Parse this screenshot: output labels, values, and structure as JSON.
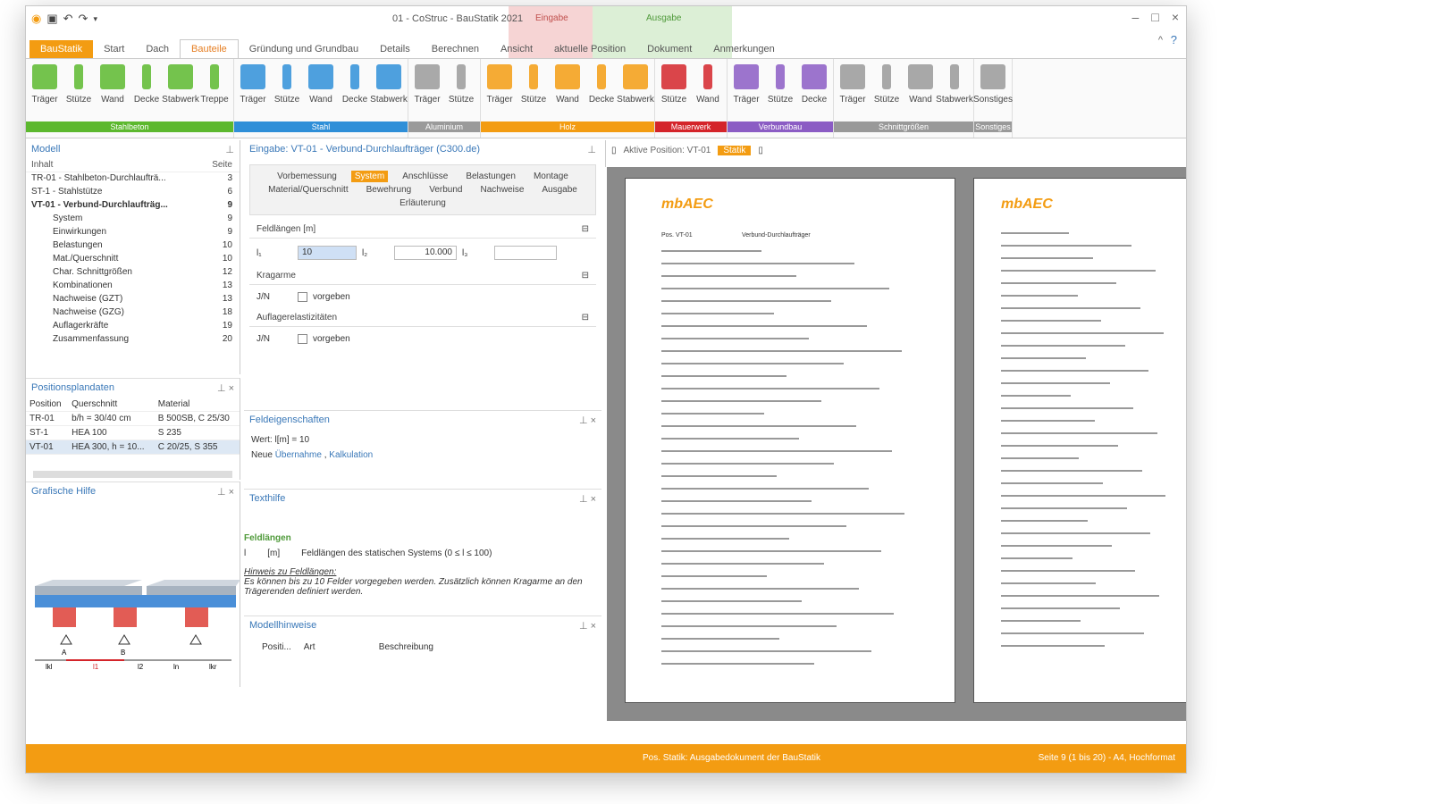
{
  "window": {
    "title": "01 - CoStruc - BauStatik 2021",
    "context_eingabe": "Eingabe",
    "context_ausgabe": "Ausgabe",
    "controls": [
      "–",
      "□",
      "×"
    ],
    "help": [
      "^",
      "?"
    ]
  },
  "tabs": [
    {
      "label": "BauStatik"
    },
    {
      "label": "Start"
    },
    {
      "label": "Dach"
    },
    {
      "label": "Bauteile"
    },
    {
      "label": "Gründung und Grundbau"
    },
    {
      "label": "Details"
    },
    {
      "label": "Berechnen"
    },
    {
      "label": "Ansicht"
    },
    {
      "label": "aktuelle Position"
    },
    {
      "label": "Dokument"
    },
    {
      "label": "Anmerkungen"
    }
  ],
  "ribbon": {
    "groups": [
      {
        "label": "Stahlbeton",
        "color": "#5cb82e",
        "items": [
          "Träger",
          "Stütze",
          "Wand",
          "Decke",
          "Stabwerk",
          "Treppe"
        ]
      },
      {
        "label": "Stahl",
        "color": "#2f8fd8",
        "items": [
          "Träger",
          "Stütze",
          "Wand",
          "Decke",
          "Stabwerk"
        ]
      },
      {
        "label": "Aluminium",
        "color": "#9a9a9a",
        "items": [
          "Träger",
          "Stütze"
        ]
      },
      {
        "label": "Holz",
        "color": "#f39c12",
        "items": [
          "Träger",
          "Stütze",
          "Wand",
          "Decke",
          "Stabwerk"
        ]
      },
      {
        "label": "Mauerwerk",
        "color": "#d4242a",
        "items": [
          "Stütze",
          "Wand"
        ]
      },
      {
        "label": "Verbundbau",
        "color": "#8b5cc4",
        "items": [
          "Träger",
          "Stütze",
          "Decke"
        ]
      },
      {
        "label": "Schnittgrößen",
        "color": "#999999",
        "items": [
          "Träger",
          "Stütze",
          "Wand",
          "Stabwerk"
        ]
      },
      {
        "label": "Sonstiges",
        "color": "#999999",
        "items": [
          "Sonstiges"
        ]
      }
    ]
  },
  "modell": {
    "title": "Modell",
    "col_inhalt": "Inhalt",
    "col_seite": "Seite",
    "rows": [
      {
        "label": "TR-01 - Stahlbeton-Durchlaufträ...",
        "page": "3"
      },
      {
        "label": "ST-1 - Stahlstütze",
        "page": "6"
      },
      {
        "label": "VT-01 - Verbund-Durchlaufträg...",
        "page": "9"
      },
      {
        "label": "System",
        "page": "9"
      },
      {
        "label": "Einwirkungen",
        "page": "9"
      },
      {
        "label": "Belastungen",
        "page": "10"
      },
      {
        "label": "Mat./Querschnitt",
        "page": "10"
      },
      {
        "label": "Char. Schnittgrößen",
        "page": "12"
      },
      {
        "label": "Kombinationen",
        "page": "13"
      },
      {
        "label": "Nachweise (GZT)",
        "page": "13"
      },
      {
        "label": "Nachweise (GZG)",
        "page": "18"
      },
      {
        "label": "Auflagerkräfte",
        "page": "19"
      },
      {
        "label": "Zusammenfassung",
        "page": "20"
      }
    ]
  },
  "positionsplan": {
    "title": "Positionsplandaten",
    "headers": [
      "Position",
      "Querschnitt",
      "Material"
    ],
    "rows": [
      [
        "TR-01",
        "b/h = 30/40 cm",
        "B 500SB, C 25/30"
      ],
      [
        "ST-1",
        "HEA 100",
        "S 235"
      ],
      [
        "VT-01",
        "HEA 300, h = 10...",
        "C 20/25, S 355"
      ]
    ]
  },
  "grafische_hilfe": {
    "title": "Grafische Hilfe",
    "labels": [
      "A",
      "B",
      "lkl",
      "l1",
      "l2",
      "ln",
      "lkr"
    ]
  },
  "eingabe": {
    "title": "Eingabe: VT-01 - Verbund-Durchlaufträger (C300.de)",
    "subtabs_row1": [
      "Vorbemessung",
      "System",
      "Anschlüsse",
      "Belastungen",
      "Montage"
    ],
    "subtabs_row2": [
      "Material/Querschnitt",
      "Bewehrung",
      "Verbund",
      "Nachweise",
      "Ausgabe"
    ],
    "subtabs_row3": [
      "Erläuterung"
    ],
    "feldlaengen_title": "Feldlängen [m]",
    "l1_label": "l₁",
    "l1_value": "10",
    "l2_label": "l₂",
    "l2_value": "10.000",
    "l3_label": "l₃",
    "kragarme_title": "Kragarme",
    "jn_label": "J/N",
    "vorgeben": "vorgeben",
    "auflager_title": "Auflagerelastizitäten"
  },
  "feldeigenschaften": {
    "title": "Feldeigenschaften",
    "wert": "Wert: l[m] = 10",
    "neue": "Neue",
    "link1": "Übernahme",
    "sep": ",",
    "link2": "Kalkulation"
  },
  "texthilfe": {
    "title": "Texthilfe",
    "heading": "Feldlängen",
    "symbol": "l",
    "unit": "[m]",
    "desc": "Feldlängen des statischen Systems (0 ≤ l ≤ 100)",
    "hint_title": "Hinweis zu Feldlängen:",
    "hint_text": "Es können bis zu 10 Felder vorgegeben werden. Zusätzlich können Kragarme an den Trägerenden definiert werden."
  },
  "modellhinweise": {
    "title": "Modellhinweise",
    "headers": [
      "Positi...",
      "Art",
      "Beschreibung"
    ]
  },
  "ausgabe": {
    "tab_aktive": "Aktive Position: VT-01",
    "tab_statik": "Statik",
    "logo": "mbAEC",
    "page1_header": "Pos. VT-01",
    "page1_title": "Verbund-Durchlaufträger"
  },
  "status": {
    "center": "Pos. Statik: Ausgabedokument der BauStatik",
    "right": "Seite 9 (1 bis 20) - A4, Hochformat"
  }
}
